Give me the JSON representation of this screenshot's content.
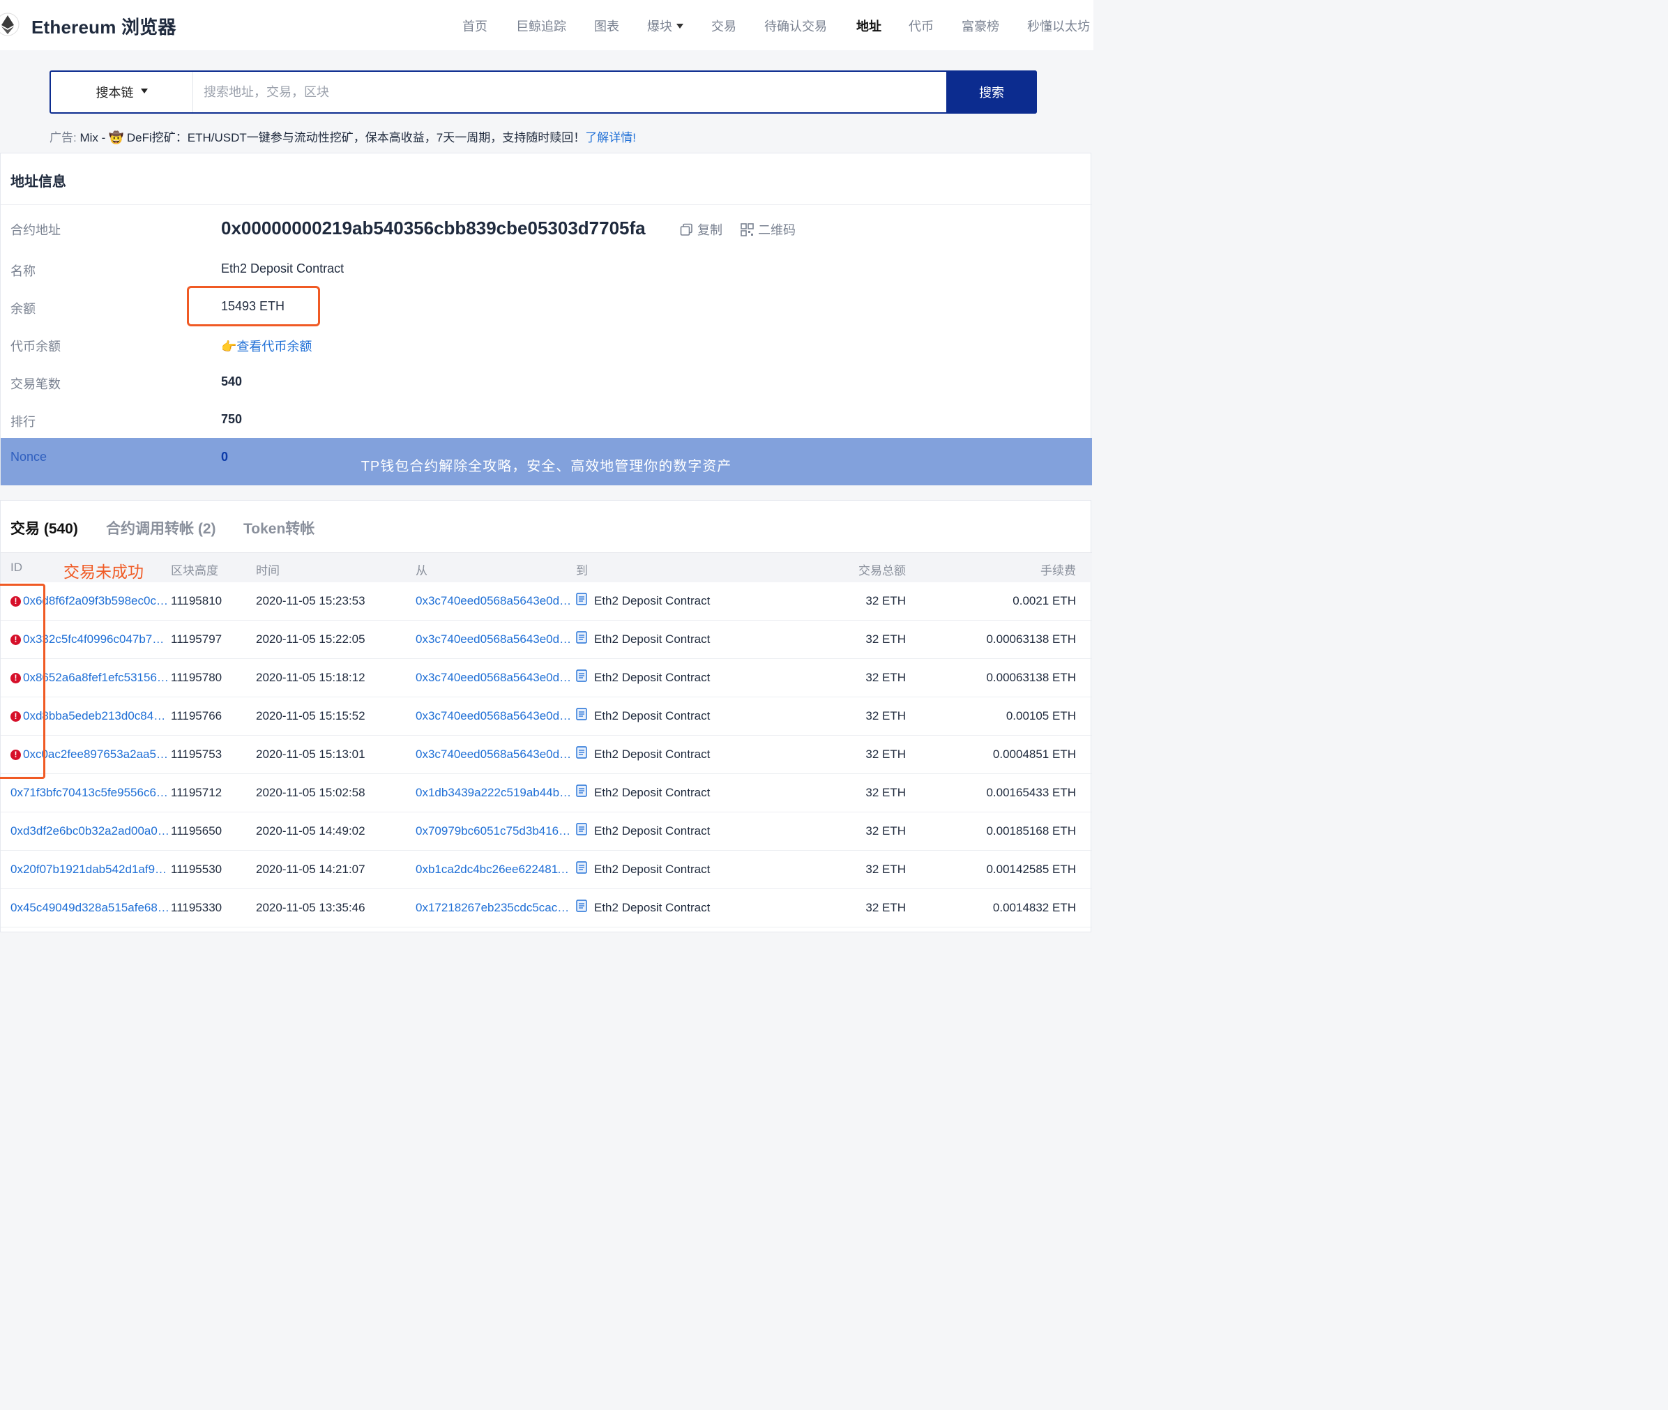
{
  "header": {
    "brand": "Ethereum 浏览器",
    "nav": [
      {
        "label": "首页",
        "active": false
      },
      {
        "label": "巨鲸追踪",
        "active": false
      },
      {
        "label": "图表",
        "active": false
      },
      {
        "label": "爆块",
        "active": false,
        "dropdown": true
      },
      {
        "label": "交易",
        "active": false
      },
      {
        "label": "待确认交易",
        "active": false
      },
      {
        "label": "地址",
        "active": true
      },
      {
        "label": "代币",
        "active": false
      },
      {
        "label": "富豪榜",
        "active": false
      },
      {
        "label": "秒懂以太坊",
        "active": false
      }
    ]
  },
  "search": {
    "scope": "搜本链",
    "placeholder": "搜索地址，交易，区块",
    "button": "搜索"
  },
  "ad": {
    "prefix": "广告:",
    "text": " Mix - 🤠 DeFi挖矿：ETH/USDT一键参与流动性挖矿，保本高收益，7天一周期，支持随时赎回！",
    "link": "了解详情!"
  },
  "address_info": {
    "title": "地址信息",
    "contract_address_label": "合约地址",
    "contract_address": "0x00000000219ab540356cbb839cbe05303d7705fa",
    "copy_label": "复制",
    "qrcode_label": "二维码",
    "name_label": "名称",
    "name": "Eth2 Deposit Contract",
    "balance_label": "余额",
    "balance": "15493 ETH",
    "token_balance_label": "代币余额",
    "token_balance_link": "👉查看代币余额",
    "tx_count_label": "交易笔数",
    "tx_count": "540",
    "rank_label": "排行",
    "rank": "750",
    "nonce_label": "Nonce",
    "nonce": "0",
    "banner_text": "TP钱包合约解除全攻略，安全、高效地管理你的数字资产"
  },
  "transactions": {
    "tabs": [
      {
        "label": "交易 (540)",
        "active": true
      },
      {
        "label": "合约调用转帐 (2)",
        "active": false
      },
      {
        "label": "Token转帐",
        "active": false
      }
    ],
    "annotation": "交易未成功",
    "columns": {
      "id": "ID",
      "block": "区块高度",
      "time": "时间",
      "from": "从",
      "to": "到",
      "amount": "交易总额",
      "fee": "手续费"
    },
    "rows": [
      {
        "failed": true,
        "id": "0x6d8f6f2a09f3b598ec0c…",
        "block": "11195810",
        "time": "2020-11-05 15:23:53",
        "from": "0x3c740eed0568a5643e0dd…",
        "to": "Eth2 Deposit Contract",
        "amount": "32 ETH",
        "fee": "0.0021 ETH"
      },
      {
        "failed": true,
        "id": "0x332c5fc4f0996c047b7d…",
        "block": "11195797",
        "time": "2020-11-05 15:22:05",
        "from": "0x3c740eed0568a5643e0dd…",
        "to": "Eth2 Deposit Contract",
        "amount": "32 ETH",
        "fee": "0.00063138 ETH"
      },
      {
        "failed": true,
        "id": "0x8652a6a8fef1efc53156…",
        "block": "11195780",
        "time": "2020-11-05 15:18:12",
        "from": "0x3c740eed0568a5643e0dd…",
        "to": "Eth2 Deposit Contract",
        "amount": "32 ETH",
        "fee": "0.00063138 ETH"
      },
      {
        "failed": true,
        "id": "0xd8bba5edeb213d0c843…",
        "block": "11195766",
        "time": "2020-11-05 15:15:52",
        "from": "0x3c740eed0568a5643e0dd…",
        "to": "Eth2 Deposit Contract",
        "amount": "32 ETH",
        "fee": "0.00105 ETH"
      },
      {
        "failed": true,
        "id": "0xc0ac2fee897653a2aa5…",
        "block": "11195753",
        "time": "2020-11-05 15:13:01",
        "from": "0x3c740eed0568a5643e0dd…",
        "to": "Eth2 Deposit Contract",
        "amount": "32 ETH",
        "fee": "0.0004851 ETH"
      },
      {
        "failed": false,
        "id": "0x71f3bfc70413c5fe9556c6…",
        "block": "11195712",
        "time": "2020-11-05 15:02:58",
        "from": "0x1db3439a222c519ab44bb…",
        "to": "Eth2 Deposit Contract",
        "amount": "32 ETH",
        "fee": "0.00165433 ETH"
      },
      {
        "failed": false,
        "id": "0xd3df2e6bc0b32a2ad00a0…",
        "block": "11195650",
        "time": "2020-11-05 14:49:02",
        "from": "0x70979bc6051c75d3b4162…",
        "to": "Eth2 Deposit Contract",
        "amount": "32 ETH",
        "fee": "0.00185168 ETH"
      },
      {
        "failed": false,
        "id": "0x20f07b1921dab542d1af9…",
        "block": "11195530",
        "time": "2020-11-05 14:21:07",
        "from": "0xb1ca2dc4bc26ee6224811…",
        "to": "Eth2 Deposit Contract",
        "amount": "32 ETH",
        "fee": "0.00142585 ETH"
      },
      {
        "failed": false,
        "id": "0x45c49049d328a515afe68…",
        "block": "11195330",
        "time": "2020-11-05 13:35:46",
        "from": "0x17218267eb235cdc5cacd…",
        "to": "Eth2 Deposit Contract",
        "amount": "32 ETH",
        "fee": "0.0014832 ETH"
      }
    ]
  }
}
